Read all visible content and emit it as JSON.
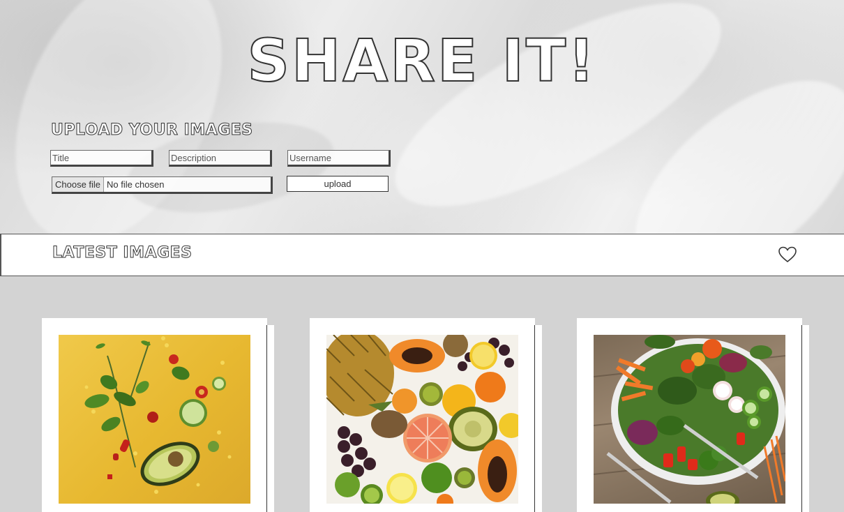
{
  "header": {
    "site_title": "SHARE IT!",
    "upload_heading": "UPLOAD YOUR IMAGES"
  },
  "form": {
    "title_placeholder": "Title",
    "description_placeholder": "Description",
    "username_placeholder": "Username",
    "file_button_label": "Choose file",
    "file_status": "No file chosen",
    "upload_button_label": "upload"
  },
  "latest": {
    "heading": "LATEST IMAGES",
    "icon": "heart-icon"
  },
  "gallery": {
    "images": [
      {
        "subject": "avocado-veggies-on-yellow"
      },
      {
        "subject": "tropical-fruit-spread"
      },
      {
        "subject": "salad-bowl"
      }
    ]
  },
  "colors": {
    "page_background": "#d3d3d3",
    "avocado_background": "#e7b830",
    "outline_text": "#333333"
  }
}
